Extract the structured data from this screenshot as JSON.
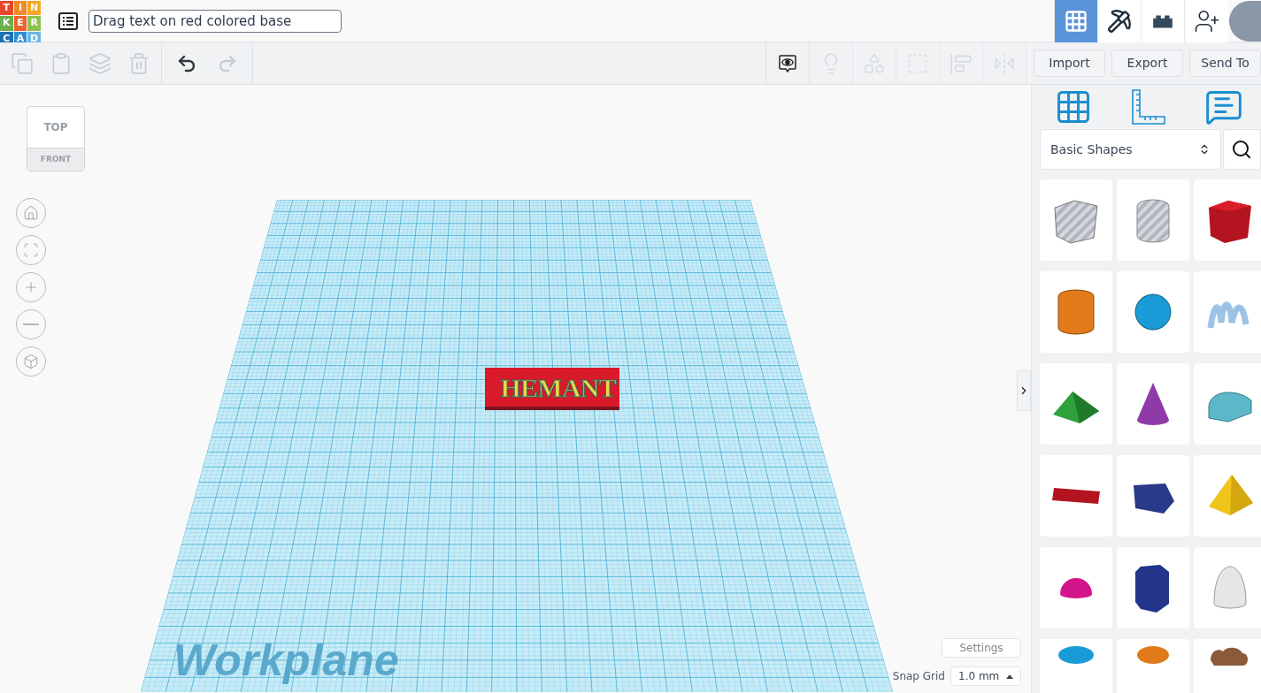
{
  "logo": {
    "letters": [
      "T",
      "I",
      "N",
      "K",
      "E",
      "R",
      "C",
      "A",
      "D"
    ]
  },
  "design_title": {
    "value": "Drag text on red colored base"
  },
  "view_modes": [
    {
      "kind": "grid",
      "selected": true
    },
    {
      "kind": "pickaxe",
      "selected": false
    },
    {
      "kind": "brick",
      "selected": false
    }
  ],
  "edit_tools": [
    {
      "kind": "copy",
      "disabled": true
    },
    {
      "kind": "paste",
      "disabled": true
    },
    {
      "kind": "duplicate",
      "disabled": true
    },
    {
      "kind": "delete",
      "disabled": true
    }
  ],
  "history_tools": [
    {
      "kind": "undo",
      "disabled": false
    },
    {
      "kind": "redo",
      "disabled": true
    }
  ],
  "view_tools": [
    {
      "kind": "notes",
      "disabled": false
    },
    {
      "kind": "bulb",
      "disabled": true
    },
    {
      "kind": "group",
      "disabled": true
    },
    {
      "kind": "ungroup",
      "disabled": true
    },
    {
      "kind": "align",
      "disabled": true
    },
    {
      "kind": "mirror",
      "disabled": true
    }
  ],
  "actions": [
    "Import",
    "Export",
    "Send To"
  ],
  "view_cube": {
    "top": "TOP",
    "front": "FRONT"
  },
  "nav_controls": [
    {
      "kind": "home"
    },
    {
      "kind": "fit"
    },
    {
      "kind": "zoom-in"
    },
    {
      "kind": "zoom-out"
    },
    {
      "kind": "ortho"
    }
  ],
  "workplane": {
    "label": "Workplane",
    "object_text": "HEMANT"
  },
  "panel_tabs": [
    {
      "kind": "grid"
    },
    {
      "kind": "ruler"
    },
    {
      "kind": "notes"
    }
  ],
  "shape_library": {
    "value": "Basic Shapes"
  },
  "shapes": [
    {
      "kind": "box-hole"
    },
    {
      "kind": "cylinder-hole"
    },
    {
      "kind": "box"
    },
    {
      "kind": "cylinder"
    },
    {
      "kind": "sphere"
    },
    {
      "kind": "scribble"
    },
    {
      "kind": "roof"
    },
    {
      "kind": "cone"
    },
    {
      "kind": "round-roof"
    },
    {
      "kind": "text"
    },
    {
      "kind": "polygon"
    },
    {
      "kind": "pyramid"
    },
    {
      "kind": "half-sphere"
    },
    {
      "kind": "prism"
    },
    {
      "kind": "paraboloid"
    },
    {
      "kind": "torus"
    },
    {
      "kind": "tube"
    },
    {
      "kind": "heart"
    }
  ],
  "settings_button": "Settings",
  "snap_grid": {
    "label": "Snap Grid",
    "value": "1.0 mm"
  }
}
